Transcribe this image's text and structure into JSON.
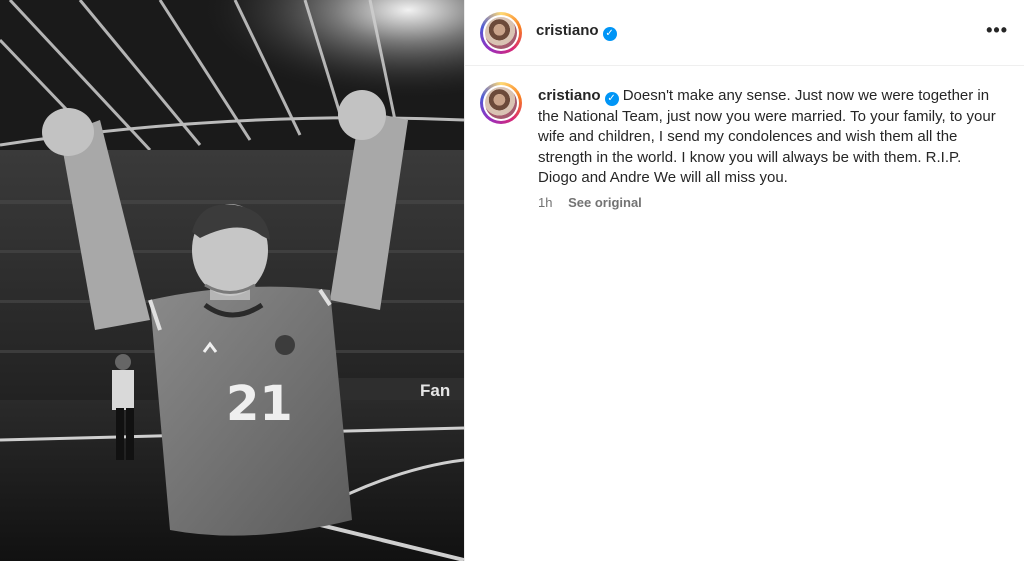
{
  "post": {
    "username": "cristiano",
    "verified": true,
    "verified_icon": "verified-badge-icon",
    "more_icon": "more-options-icon",
    "more_label": "•••",
    "caption": "Doesn't make any sense. Just now we were together in the National Team, just now you were married. To your family, to your wife and children, I send my condolences and wish them all the strength in the world. I know you will always be with them. R.I.P. Diogo and Andre We will all miss you.",
    "time_ago": "1h",
    "see_original_label": "See original",
    "image": {
      "jersey_number": "21",
      "ad_board_text": "Fan",
      "style": "black-and-white"
    }
  },
  "colors": {
    "verified_blue": "#0095f6",
    "text": "#262626",
    "muted": "#737373"
  }
}
